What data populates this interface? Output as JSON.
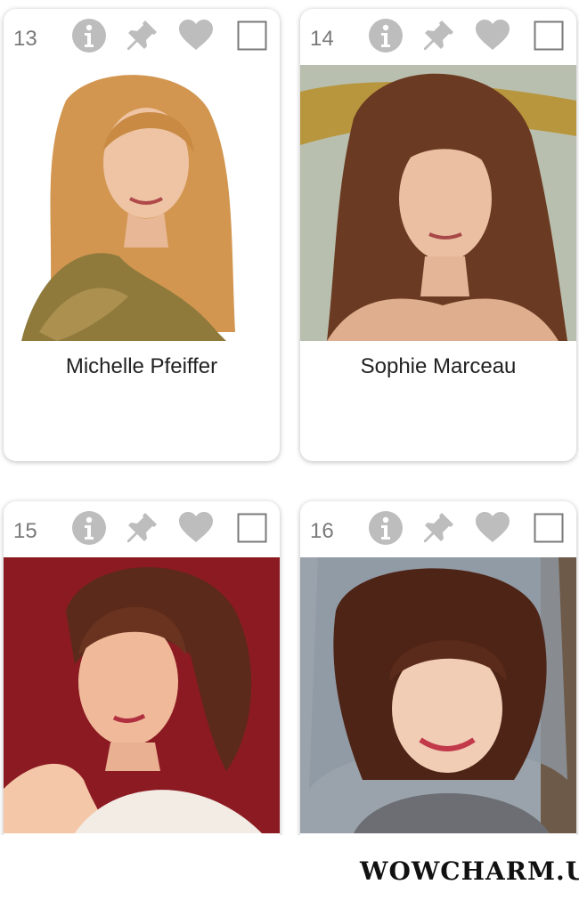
{
  "cards": [
    {
      "number": "13",
      "name": "Michelle Pfeiffer"
    },
    {
      "number": "14",
      "name": "Sophie Marceau"
    },
    {
      "number": "15",
      "name": ""
    },
    {
      "number": "16",
      "name": ""
    }
  ],
  "icons": [
    "info-icon",
    "pin-icon",
    "heart-icon",
    "checkbox"
  ],
  "colors": {
    "icon_gray": "#bdbdbd",
    "number_gray": "#7a7a7a"
  },
  "watermark": "WOWCHARM.US"
}
